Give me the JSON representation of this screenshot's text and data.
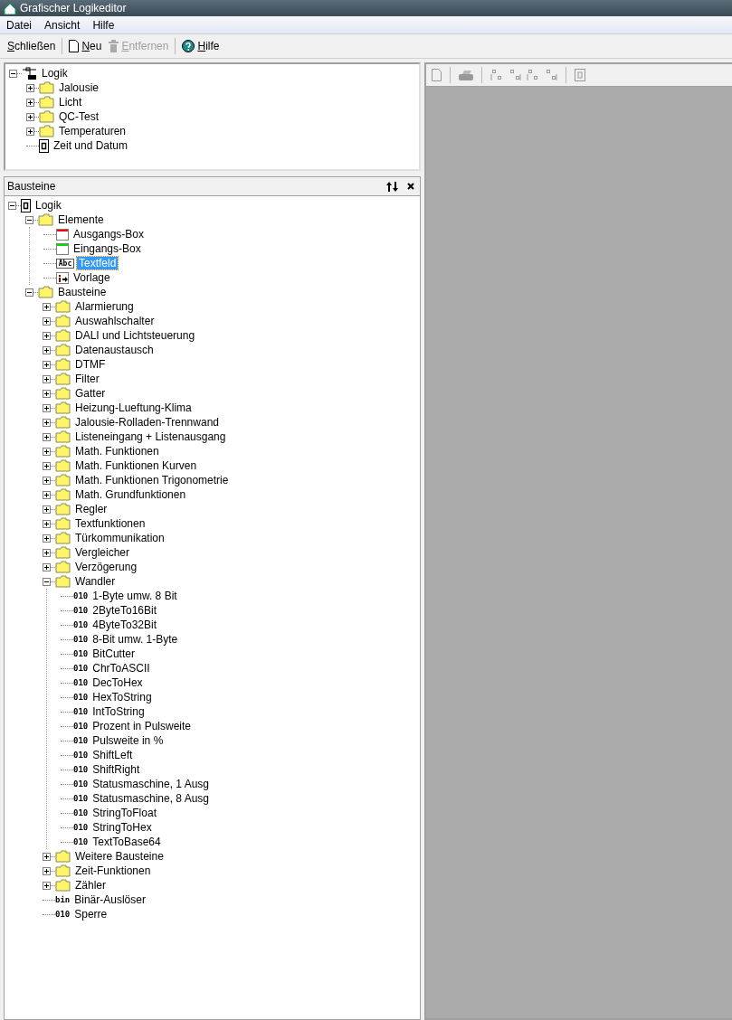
{
  "window": {
    "title": "Grafischer Logikeditor"
  },
  "menu": [
    "Datei",
    "Ansicht",
    "Hilfe"
  ],
  "toolbar": [
    {
      "label": "Schließen",
      "kind": "text",
      "disabled": false
    },
    {
      "label": "Neu",
      "kind": "page",
      "disabled": false
    },
    {
      "label": "Entfernen",
      "kind": "trash",
      "disabled": true
    },
    {
      "label": "Hilfe",
      "kind": "help",
      "disabled": false
    }
  ],
  "project_tree": [
    {
      "label": "Logik",
      "kind": "network",
      "expanded": true,
      "selected": false,
      "children": [
        {
          "label": "Jalousie",
          "kind": "folder",
          "expanded": false,
          "selected": false
        },
        {
          "label": "Licht",
          "kind": "folder",
          "expanded": false,
          "selected": false
        },
        {
          "label": "QC-Test",
          "kind": "folder",
          "expanded": false,
          "selected": false
        },
        {
          "label": "Temperaturen",
          "kind": "folder",
          "expanded": false,
          "selected": false
        },
        {
          "label": "Zeit und Datum",
          "kind": "block",
          "selected": false
        }
      ]
    }
  ],
  "bausteine_panel": {
    "title": "Bausteine",
    "tree": [
      {
        "label": "Logik",
        "kind": "block",
        "expanded": true,
        "selected": false,
        "children": [
          {
            "label": "Elemente",
            "kind": "folder",
            "expanded": true,
            "selected": false,
            "children": [
              {
                "label": "Ausgangs-Box",
                "kind": "output",
                "selected": false
              },
              {
                "label": "Eingangs-Box",
                "kind": "input",
                "selected": false
              },
              {
                "label": "Textfeld",
                "kind": "textfield",
                "tag": "Abc",
                "selected": true
              },
              {
                "label": "Vorlage",
                "kind": "template",
                "selected": false
              }
            ]
          },
          {
            "label": "Bausteine",
            "kind": "folder",
            "expanded": true,
            "selected": false,
            "children": [
              {
                "label": "Alarmierung",
                "kind": "folder",
                "expanded": false,
                "selected": false
              },
              {
                "label": "Auswahlschalter",
                "kind": "folder",
                "expanded": false,
                "selected": false
              },
              {
                "label": "DALI und Lichtsteuerung",
                "kind": "folder",
                "expanded": false,
                "selected": false
              },
              {
                "label": "Datenaustausch",
                "kind": "folder",
                "expanded": false,
                "selected": false
              },
              {
                "label": "DTMF",
                "kind": "folder",
                "expanded": false,
                "selected": false
              },
              {
                "label": "Filter",
                "kind": "folder",
                "expanded": false,
                "selected": false
              },
              {
                "label": "Gatter",
                "kind": "folder",
                "expanded": false,
                "selected": false
              },
              {
                "label": "Heizung-Lueftung-Klima",
                "kind": "folder",
                "expanded": false,
                "selected": false
              },
              {
                "label": "Jalousie-Rolladen-Trennwand",
                "kind": "folder",
                "expanded": false,
                "selected": false
              },
              {
                "label": "Listeneingang + Listenausgang",
                "kind": "folder",
                "expanded": false,
                "selected": false
              },
              {
                "label": "Math. Funktionen",
                "kind": "folder",
                "expanded": false,
                "selected": false
              },
              {
                "label": "Math. Funktionen Kurven",
                "kind": "folder",
                "expanded": false,
                "selected": false
              },
              {
                "label": "Math. Funktionen Trigonometrie",
                "kind": "folder",
                "expanded": false,
                "selected": false
              },
              {
                "label": "Math. Grundfunktionen",
                "kind": "folder",
                "expanded": false,
                "selected": false
              },
              {
                "label": "Regler",
                "kind": "folder",
                "expanded": false,
                "selected": false
              },
              {
                "label": "Textfunktionen",
                "kind": "folder",
                "expanded": false,
                "selected": false
              },
              {
                "label": "Türkommunikation",
                "kind": "folder",
                "expanded": false,
                "selected": false
              },
              {
                "label": "Vergleicher",
                "kind": "folder",
                "expanded": false,
                "selected": false
              },
              {
                "label": "Verzögerung",
                "kind": "folder",
                "expanded": false,
                "selected": false
              },
              {
                "label": "Wandler",
                "kind": "folder",
                "expanded": true,
                "selected": false,
                "children": [
                  {
                    "label": "1-Byte umw. 8 Bit",
                    "kind": "code",
                    "tag": "010",
                    "selected": false
                  },
                  {
                    "label": "2ByteTo16Bit",
                    "kind": "code",
                    "tag": "010",
                    "selected": false
                  },
                  {
                    "label": "4ByteTo32Bit",
                    "kind": "code",
                    "tag": "010",
                    "selected": false
                  },
                  {
                    "label": "8-Bit umw. 1-Byte",
                    "kind": "code",
                    "tag": "010",
                    "selected": false
                  },
                  {
                    "label": "BitCutter",
                    "kind": "code",
                    "tag": "010",
                    "selected": false
                  },
                  {
                    "label": "ChrToASCII",
                    "kind": "code",
                    "tag": "010",
                    "selected": false
                  },
                  {
                    "label": "DecToHex",
                    "kind": "code",
                    "tag": "010",
                    "selected": false
                  },
                  {
                    "label": "HexToString",
                    "kind": "code",
                    "tag": "010",
                    "selected": false
                  },
                  {
                    "label": "IntToString",
                    "kind": "code",
                    "tag": "010",
                    "selected": false
                  },
                  {
                    "label": "Prozent in Pulsweite",
                    "kind": "code",
                    "tag": "010",
                    "selected": false
                  },
                  {
                    "label": "Pulsweite in %",
                    "kind": "code",
                    "tag": "010",
                    "selected": false
                  },
                  {
                    "label": "ShiftLeft",
                    "kind": "code",
                    "tag": "010",
                    "selected": false
                  },
                  {
                    "label": "ShiftRight",
                    "kind": "code",
                    "tag": "010",
                    "selected": false
                  },
                  {
                    "label": "Statusmaschine, 1 Ausg",
                    "kind": "code",
                    "tag": "010",
                    "selected": false
                  },
                  {
                    "label": "Statusmaschine, 8 Ausg",
                    "kind": "code",
                    "tag": "010",
                    "selected": false
                  },
                  {
                    "label": "StringToFloat",
                    "kind": "code",
                    "tag": "010",
                    "selected": false
                  },
                  {
                    "label": "StringToHex",
                    "kind": "code",
                    "tag": "010",
                    "selected": false
                  },
                  {
                    "label": "TextToBase64",
                    "kind": "code",
                    "tag": "010",
                    "selected": false
                  }
                ]
              },
              {
                "label": "Weitere Bausteine",
                "kind": "folder",
                "expanded": false,
                "selected": false
              },
              {
                "label": "Zeit-Funktionen",
                "kind": "folder",
                "expanded": false,
                "selected": false
              },
              {
                "label": "Zähler",
                "kind": "folder",
                "expanded": false,
                "selected": false
              },
              {
                "label": "Binär-Auslöser",
                "kind": "code",
                "tag": "bin",
                "selected": false
              },
              {
                "label": "Sperre",
                "kind": "code",
                "tag": "010",
                "selected": false
              }
            ]
          }
        ]
      }
    ]
  }
}
